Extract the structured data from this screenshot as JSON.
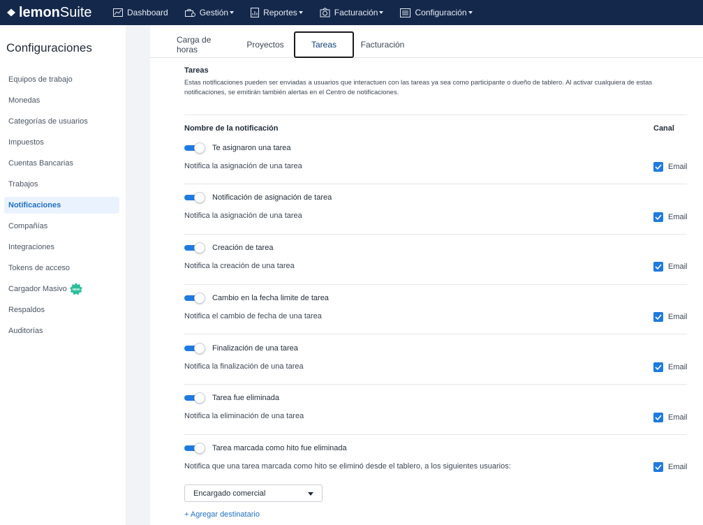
{
  "brand": {
    "bold": "lemon",
    "light": "Suite"
  },
  "nav": [
    {
      "label": "Dashboard",
      "icon": "chart-line-icon",
      "dropdown": false
    },
    {
      "label": "Gestión",
      "icon": "briefcase-icon",
      "dropdown": true
    },
    {
      "label": "Reportes",
      "icon": "report-icon",
      "dropdown": true
    },
    {
      "label": "Facturación",
      "icon": "invoice-icon",
      "dropdown": true
    },
    {
      "label": "Configuración",
      "icon": "settings-list-icon",
      "dropdown": true
    }
  ],
  "sidebar": {
    "title": "Configuraciones",
    "items": [
      {
        "label": "Equipos de trabajo"
      },
      {
        "label": "Monedas"
      },
      {
        "label": "Categorías de usuarios"
      },
      {
        "label": "Impuestos"
      },
      {
        "label": "Cuentas Bancarias"
      },
      {
        "label": "Trabajos"
      },
      {
        "label": "Notificaciones",
        "active": true
      },
      {
        "label": "Compañías"
      },
      {
        "label": "Integraciones"
      },
      {
        "label": "Tokens de acceso"
      },
      {
        "label": "Cargador Masivo",
        "badge": "NEW"
      },
      {
        "label": "Respaldos"
      },
      {
        "label": "Auditorías"
      }
    ]
  },
  "tabs": [
    {
      "label": "Carga de horas"
    },
    {
      "label": "Proyectos"
    },
    {
      "label": "Tareas",
      "active": true
    },
    {
      "label": "Facturación"
    }
  ],
  "section": {
    "title": "Tareas",
    "description": "Estas notificaciones pueden ser enviadas a usuarios que interactuen con las tareas ya sea como participante o dueño de tablero. Al activar cualquiera de estas notificaciones, se emitirán también alertas en el Centro de notificaciones."
  },
  "columns": {
    "name": "Nombre de la notificación",
    "channel": "Canal"
  },
  "notifications": [
    {
      "title": "Te asignaron una tarea",
      "description": "Notifica la asignación de una tarea",
      "enabled": true,
      "channel": "Email",
      "checked": true
    },
    {
      "title": "Notificación de asignación de tarea",
      "description": "Notifica la asignación de una tarea",
      "enabled": true,
      "channel": "Email",
      "checked": true
    },
    {
      "title": "Creación de tarea",
      "description": "Notifica la creación de una tarea",
      "enabled": true,
      "channel": "Email",
      "checked": true
    },
    {
      "title": "Cambio en la fecha limite de tarea",
      "description": "Notifica el cambio de fecha de una tarea",
      "enabled": true,
      "channel": "Email",
      "checked": true
    },
    {
      "title": "Finalización de una tarea",
      "description": "Notifica la finalización de una tarea",
      "enabled": true,
      "channel": "Email",
      "checked": true
    },
    {
      "title": "Tarea fue eliminada",
      "description": "Notifica la eliminación de una tarea",
      "enabled": true,
      "channel": "Email",
      "checked": true
    },
    {
      "title": "Tarea marcada como hito fue eliminada",
      "description": "Notifica que una tarea marcada como hito se eliminó desde el tablero, a los siguientes usuarios:",
      "enabled": true,
      "channel": "Email",
      "checked": true
    }
  ],
  "recipient_select": {
    "value": "Encargado comercial"
  },
  "add_recipient": "+ Agregar destinatario",
  "colors": {
    "topbar": "#14284b",
    "accent": "#1f7ae0",
    "active_bg": "#eaf3fd",
    "badge": "#2bbf9a"
  }
}
